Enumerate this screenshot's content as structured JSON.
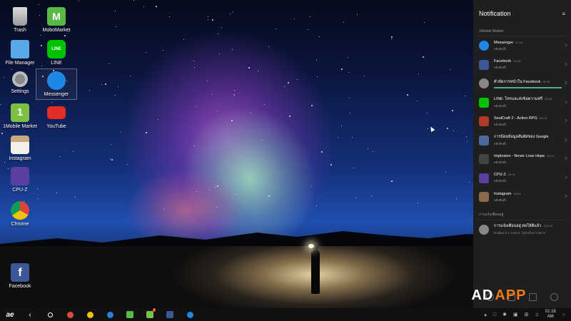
{
  "desktop": {
    "icons": [
      {
        "label": "Trash",
        "icon": "trash-icon"
      },
      {
        "label": "MoboMarket",
        "icon": "mobomarket-icon"
      },
      {
        "label": "File Manager",
        "icon": "folder-icon"
      },
      {
        "label": "LINE",
        "icon": "line-icon"
      },
      {
        "label": "Settings",
        "icon": "gear-icon"
      },
      {
        "label": "Messenger",
        "icon": "messenger-icon"
      },
      {
        "label": "1Mobile Market",
        "icon": "1mobile-market-icon"
      },
      {
        "label": "YouTube",
        "icon": "youtube-icon"
      },
      {
        "label": "Instagram",
        "icon": "instagram-icon"
      },
      {
        "label": "CPU-Z",
        "icon": "cpu-z-icon"
      },
      {
        "label": "Chrome",
        "icon": "chrome-icon"
      },
      {
        "label": "Facebook",
        "icon": "facebook-icon"
      }
    ]
  },
  "notification_panel": {
    "title": "Notification",
    "section_1": "1Mobile Market",
    "section_2": "การแจ้งเตือนอยู่",
    "items": [
      {
        "title": "Messenger",
        "time": "01:14",
        "sub": "คลิกติดตั้ง",
        "color": "#1e88e5",
        "icon": "messenger-icon"
      },
      {
        "title": "Facebook",
        "time": "01:13",
        "sub": "คลิกติดตั้ง",
        "color": "#3b5998",
        "icon": "facebook-icon"
      },
      {
        "title": "ตัวจัดการหน้าใน Facebook",
        "time": "01:09",
        "sub": "",
        "color": "#888888",
        "icon": "download-icon",
        "progress": 1.0
      },
      {
        "title": "LINE: โทรและส่งข้อความฟรี",
        "time": "00:28",
        "sub": "คลิกติดตั้ง",
        "color": "#00c300",
        "icon": "line-icon"
      },
      {
        "title": "SoulCraft 2 - Action RPG",
        "time": "00:24",
        "sub": "คลิกติดตั้ง",
        "color": "#b33a2a",
        "icon": "soulcraft-icon"
      },
      {
        "title": "การป้อนข้อมูลสัมผัสของ Google",
        "time": "",
        "sub": "คลิกติดตั้ง",
        "color": "#4a6a9a",
        "icon": "google-input-icon"
      },
      {
        "title": "Implosion - Never Lose Hope",
        "time": "00:14",
        "sub": "คลิกติดตั้ง",
        "color": "#444444",
        "icon": "implosion-icon"
      },
      {
        "title": "CPU-Z",
        "time": "00:11",
        "sub": "คลิกติดตั้ง",
        "color": "#5a3fa0",
        "icon": "cpu-z-icon"
      },
      {
        "title": "Instagram",
        "time": "00:06",
        "sub": "คลิกติดตั้ง",
        "color": "#8a6a4a",
        "icon": "instagram-icon"
      }
    ],
    "update_item": {
      "title": "การแจ้งเตือนอยู่ ต่อให้ดีแล้ว",
      "time": "12/1/15",
      "sub": "ดำเนินการ 1 รายการ, ไม่สำเร็จ 0 รายการ",
      "icon": "upload-icon"
    }
  },
  "taskbar": {
    "start_icon": "start-icon",
    "back_icon": "back-icon",
    "home_icon": "home-icon",
    "apps": [
      {
        "icon": "chrome-icon",
        "color": "#e04a3a"
      },
      {
        "icon": "gallery-icon",
        "color": "#f4c20d"
      },
      {
        "icon": "globe-icon",
        "color": "#2a7fd8"
      },
      {
        "icon": "mobomarket-icon",
        "color": "#58b947"
      },
      {
        "icon": "1mobile-market-icon",
        "color": "#7bc043",
        "badge": "9"
      },
      {
        "icon": "facebook-icon",
        "color": "#3b5998"
      },
      {
        "icon": "messenger-icon",
        "color": "#1e88e5"
      }
    ],
    "clock_time": "01:18",
    "clock_sub": "AM"
  },
  "watermark": {
    "prefix": "AD",
    "brand": "APP"
  }
}
